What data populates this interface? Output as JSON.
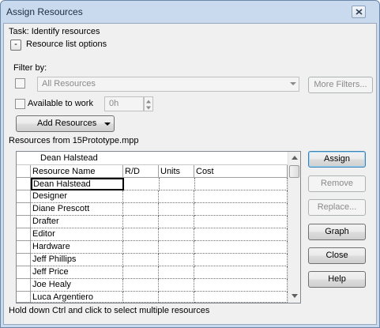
{
  "window": {
    "title": "Assign Resources"
  },
  "task": {
    "label": "Task: Identify resources"
  },
  "options": {
    "toggle_glyph": "-",
    "label": "Resource list options"
  },
  "filter": {
    "label": "Filter by:",
    "value": "All Resources",
    "more_label": "More Filters..."
  },
  "available": {
    "label": "Available to work",
    "hours": "0h"
  },
  "add_resources": {
    "label": "Add Resources"
  },
  "resources": {
    "label": "Resources from 15Prototype.mpp",
    "edit_value": "Dean Halstead",
    "columns": {
      "name": "Resource Name",
      "rd": "R/D",
      "units": "Units",
      "cost": "Cost"
    },
    "rows": [
      {
        "name": "Dean Halstead"
      },
      {
        "name": "Designer"
      },
      {
        "name": "Diane Prescott"
      },
      {
        "name": "Drafter"
      },
      {
        "name": "Editor"
      },
      {
        "name": "Hardware"
      },
      {
        "name": "Jeff Phillips"
      },
      {
        "name": "Jeff Price"
      },
      {
        "name": "Joe Healy"
      },
      {
        "name": "Luca Argentiero"
      }
    ]
  },
  "buttons": {
    "assign": "Assign",
    "remove": "Remove",
    "replace": "Replace...",
    "graph": "Graph",
    "close": "Close",
    "help": "Help"
  },
  "hint": "Hold down Ctrl and click to select multiple resources",
  "colors": {
    "title_bar": "#c9daee",
    "dialog": "#f0f0f0",
    "default_button_border": "#3c7fb1"
  }
}
